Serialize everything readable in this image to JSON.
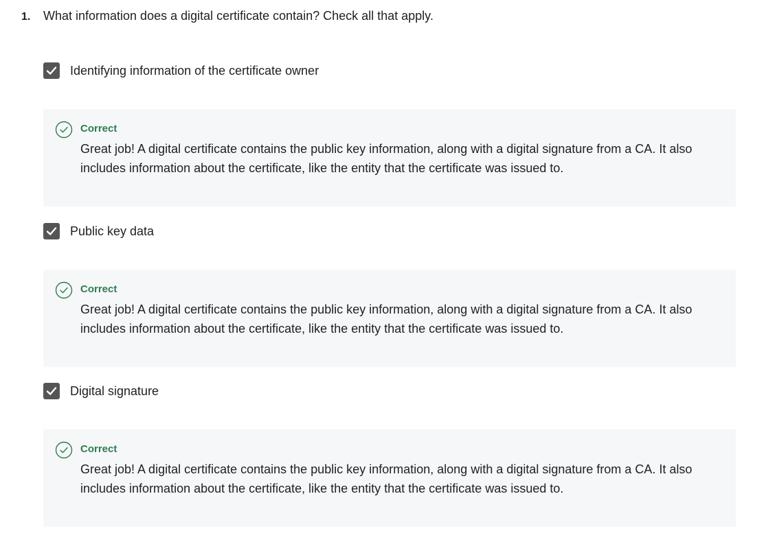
{
  "question": {
    "number": "1.",
    "text": "What information does a digital certificate contain? Check all that apply."
  },
  "options": [
    {
      "label": "Identifying information of the certificate owner",
      "checked": true,
      "feedback": {
        "status": "Correct",
        "message": "Great job! A digital certificate contains the public key information, along with a digital signature from a CA. It also includes information about the certificate, like the entity that the certificate was issued to."
      }
    },
    {
      "label": "Public key data",
      "checked": true,
      "feedback": {
        "status": "Correct",
        "message": "Great job! A digital certificate contains the public key information, along with a digital signature from a CA. It also includes information about the certificate, like the entity that the certificate was issued to."
      }
    },
    {
      "label": "Digital signature",
      "checked": true,
      "feedback": {
        "status": "Correct",
        "message": "Great job! A digital certificate contains the public key information, along with a digital signature from a CA. It also includes information about the certificate, like the entity that the certificate was issued to."
      }
    }
  ],
  "icons": {
    "checkbox": "checkmark-icon",
    "feedback": "check-circle-icon"
  },
  "colors": {
    "checkbox_fill": "#555555",
    "correct_green": "#2e7d4f",
    "feedback_bg": "#f5f7f8"
  }
}
